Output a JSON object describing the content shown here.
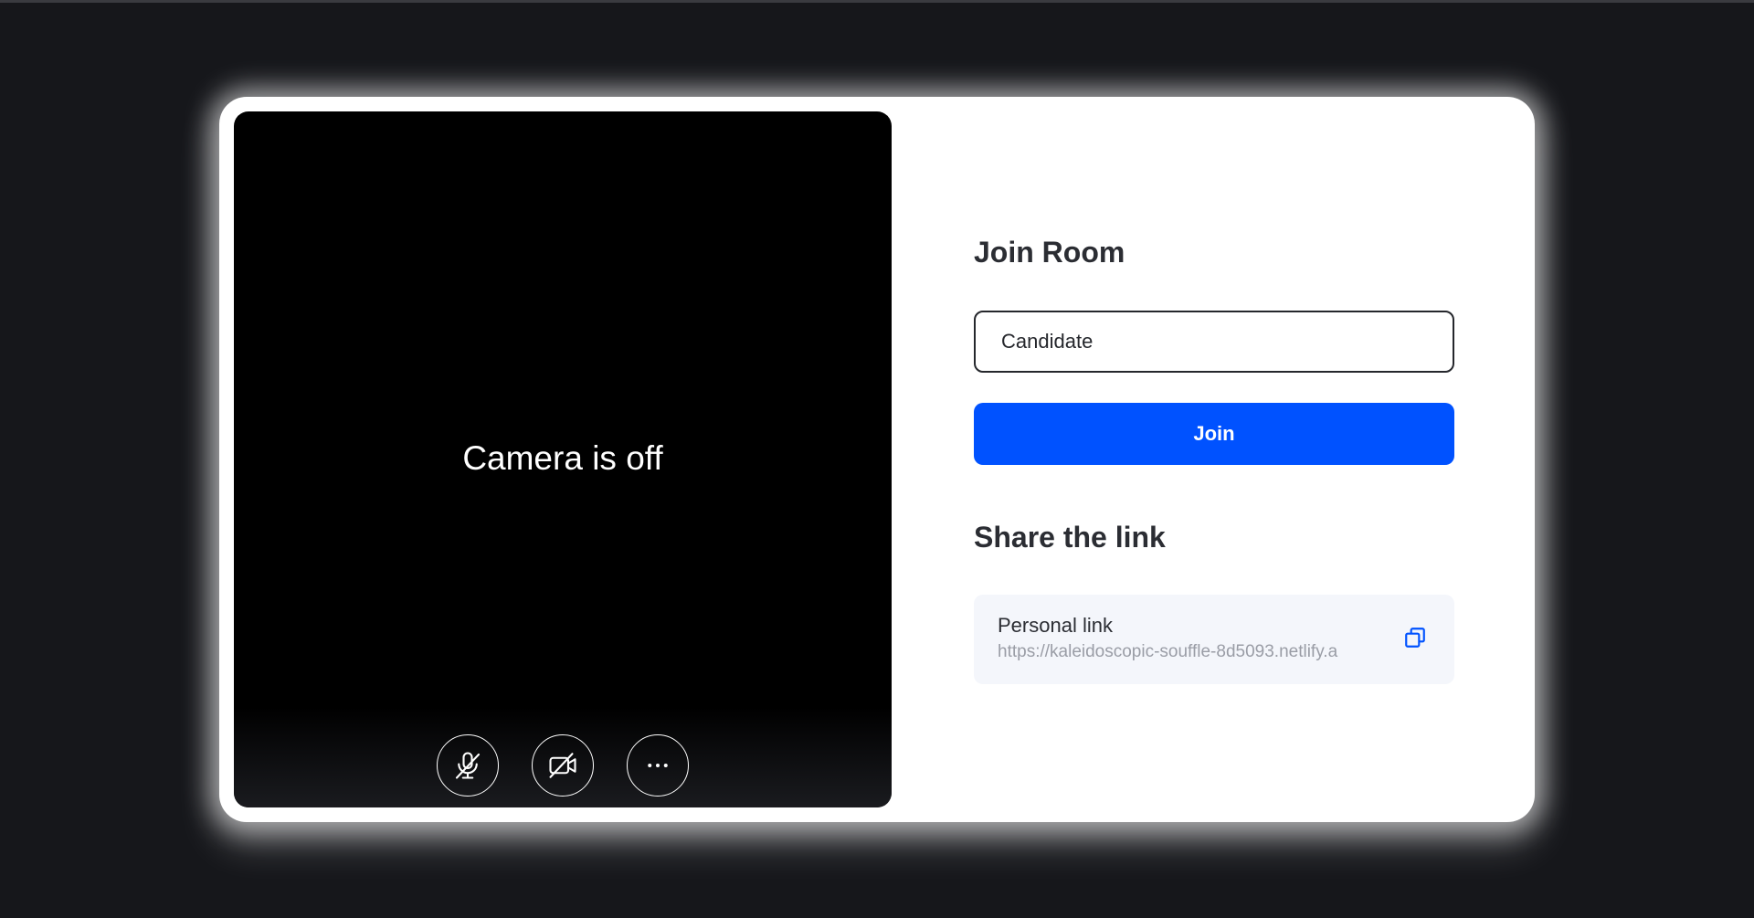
{
  "video": {
    "status_text": "Camera is off",
    "controls": [
      {
        "name": "microphone-off",
        "icon": "mic-off-icon"
      },
      {
        "name": "camera-off",
        "icon": "video-off-icon"
      },
      {
        "name": "more-options",
        "icon": "more-horizontal-icon"
      }
    ]
  },
  "join": {
    "title": "Join Room",
    "name_value": "Candidate",
    "button_label": "Join"
  },
  "share": {
    "title": "Share the link",
    "link_label": "Personal link",
    "link_url": "https://kaleidoscopic-souffle-8d5093.netlify.a",
    "copy_icon": "copy-icon"
  },
  "colors": {
    "background": "#16171b",
    "card": "#ffffff",
    "accent": "#0052ff",
    "link_box": "#f4f6fb"
  }
}
